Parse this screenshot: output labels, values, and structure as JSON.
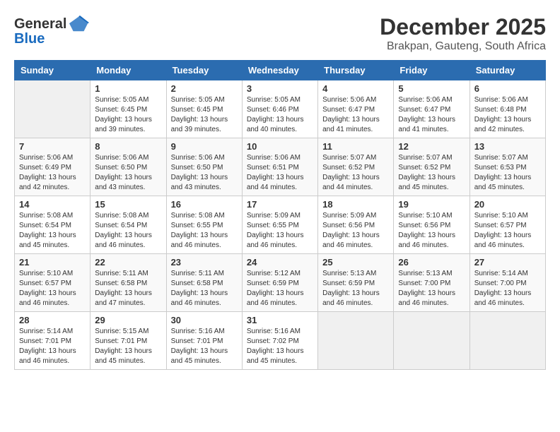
{
  "header": {
    "logo_line1": "General",
    "logo_line2": "Blue",
    "month_year": "December 2025",
    "location": "Brakpan, Gauteng, South Africa"
  },
  "days_of_week": [
    "Sunday",
    "Monday",
    "Tuesday",
    "Wednesday",
    "Thursday",
    "Friday",
    "Saturday"
  ],
  "weeks": [
    [
      {
        "day": "",
        "info": ""
      },
      {
        "day": "1",
        "info": "Sunrise: 5:05 AM\nSunset: 6:45 PM\nDaylight: 13 hours\nand 39 minutes."
      },
      {
        "day": "2",
        "info": "Sunrise: 5:05 AM\nSunset: 6:45 PM\nDaylight: 13 hours\nand 39 minutes."
      },
      {
        "day": "3",
        "info": "Sunrise: 5:05 AM\nSunset: 6:46 PM\nDaylight: 13 hours\nand 40 minutes."
      },
      {
        "day": "4",
        "info": "Sunrise: 5:06 AM\nSunset: 6:47 PM\nDaylight: 13 hours\nand 41 minutes."
      },
      {
        "day": "5",
        "info": "Sunrise: 5:06 AM\nSunset: 6:47 PM\nDaylight: 13 hours\nand 41 minutes."
      },
      {
        "day": "6",
        "info": "Sunrise: 5:06 AM\nSunset: 6:48 PM\nDaylight: 13 hours\nand 42 minutes."
      }
    ],
    [
      {
        "day": "7",
        "info": "Sunrise: 5:06 AM\nSunset: 6:49 PM\nDaylight: 13 hours\nand 42 minutes."
      },
      {
        "day": "8",
        "info": "Sunrise: 5:06 AM\nSunset: 6:50 PM\nDaylight: 13 hours\nand 43 minutes."
      },
      {
        "day": "9",
        "info": "Sunrise: 5:06 AM\nSunset: 6:50 PM\nDaylight: 13 hours\nand 43 minutes."
      },
      {
        "day": "10",
        "info": "Sunrise: 5:06 AM\nSunset: 6:51 PM\nDaylight: 13 hours\nand 44 minutes."
      },
      {
        "day": "11",
        "info": "Sunrise: 5:07 AM\nSunset: 6:52 PM\nDaylight: 13 hours\nand 44 minutes."
      },
      {
        "day": "12",
        "info": "Sunrise: 5:07 AM\nSunset: 6:52 PM\nDaylight: 13 hours\nand 45 minutes."
      },
      {
        "day": "13",
        "info": "Sunrise: 5:07 AM\nSunset: 6:53 PM\nDaylight: 13 hours\nand 45 minutes."
      }
    ],
    [
      {
        "day": "14",
        "info": "Sunrise: 5:08 AM\nSunset: 6:54 PM\nDaylight: 13 hours\nand 45 minutes."
      },
      {
        "day": "15",
        "info": "Sunrise: 5:08 AM\nSunset: 6:54 PM\nDaylight: 13 hours\nand 46 minutes."
      },
      {
        "day": "16",
        "info": "Sunrise: 5:08 AM\nSunset: 6:55 PM\nDaylight: 13 hours\nand 46 minutes."
      },
      {
        "day": "17",
        "info": "Sunrise: 5:09 AM\nSunset: 6:55 PM\nDaylight: 13 hours\nand 46 minutes."
      },
      {
        "day": "18",
        "info": "Sunrise: 5:09 AM\nSunset: 6:56 PM\nDaylight: 13 hours\nand 46 minutes."
      },
      {
        "day": "19",
        "info": "Sunrise: 5:10 AM\nSunset: 6:56 PM\nDaylight: 13 hours\nand 46 minutes."
      },
      {
        "day": "20",
        "info": "Sunrise: 5:10 AM\nSunset: 6:57 PM\nDaylight: 13 hours\nand 46 minutes."
      }
    ],
    [
      {
        "day": "21",
        "info": "Sunrise: 5:10 AM\nSunset: 6:57 PM\nDaylight: 13 hours\nand 46 minutes."
      },
      {
        "day": "22",
        "info": "Sunrise: 5:11 AM\nSunset: 6:58 PM\nDaylight: 13 hours\nand 47 minutes."
      },
      {
        "day": "23",
        "info": "Sunrise: 5:11 AM\nSunset: 6:58 PM\nDaylight: 13 hours\nand 46 minutes."
      },
      {
        "day": "24",
        "info": "Sunrise: 5:12 AM\nSunset: 6:59 PM\nDaylight: 13 hours\nand 46 minutes."
      },
      {
        "day": "25",
        "info": "Sunrise: 5:13 AM\nSunset: 6:59 PM\nDaylight: 13 hours\nand 46 minutes."
      },
      {
        "day": "26",
        "info": "Sunrise: 5:13 AM\nSunset: 7:00 PM\nDaylight: 13 hours\nand 46 minutes."
      },
      {
        "day": "27",
        "info": "Sunrise: 5:14 AM\nSunset: 7:00 PM\nDaylight: 13 hours\nand 46 minutes."
      }
    ],
    [
      {
        "day": "28",
        "info": "Sunrise: 5:14 AM\nSunset: 7:01 PM\nDaylight: 13 hours\nand 46 minutes."
      },
      {
        "day": "29",
        "info": "Sunrise: 5:15 AM\nSunset: 7:01 PM\nDaylight: 13 hours\nand 45 minutes."
      },
      {
        "day": "30",
        "info": "Sunrise: 5:16 AM\nSunset: 7:01 PM\nDaylight: 13 hours\nand 45 minutes."
      },
      {
        "day": "31",
        "info": "Sunrise: 5:16 AM\nSunset: 7:02 PM\nDaylight: 13 hours\nand 45 minutes."
      },
      {
        "day": "",
        "info": ""
      },
      {
        "day": "",
        "info": ""
      },
      {
        "day": "",
        "info": ""
      }
    ]
  ]
}
